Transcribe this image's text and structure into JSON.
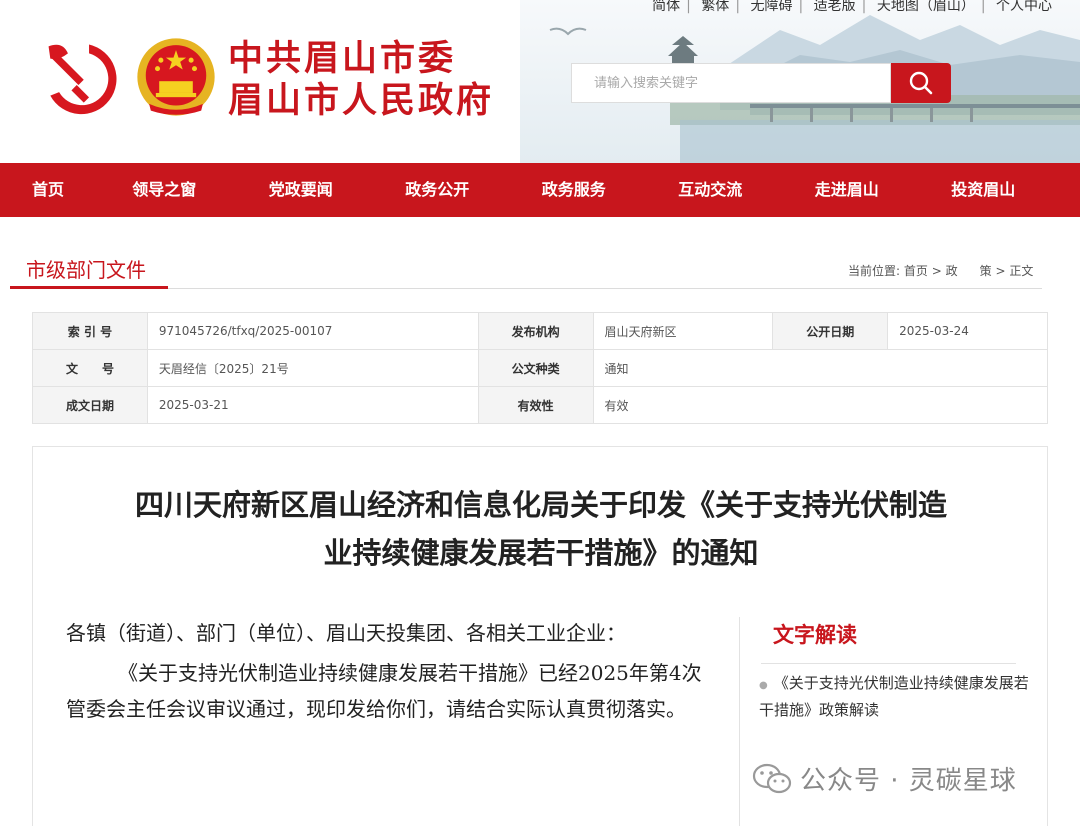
{
  "header": {
    "top_links": [
      "简体",
      "繁体",
      "无障碍",
      "适老版",
      "天地图（眉山）",
      "个人中心"
    ],
    "title_line1": "中共眉山市委",
    "title_line2": "眉山市人民政府",
    "search_placeholder": "请输入搜索关键字",
    "search_icon": "search-icon"
  },
  "nav": {
    "items": [
      "首页",
      "领导之窗",
      "党政要闻",
      "政务公开",
      "政务服务",
      "互动交流",
      "走进眉山",
      "投资眉山"
    ]
  },
  "section": {
    "title": "市级部门文件",
    "breadcrumb_prefix": "当前位置:",
    "breadcrumb_home": "首页",
    "breadcrumb_part1": "政",
    "breadcrumb_part2": "策",
    "breadcrumb_current": "正文"
  },
  "meta": {
    "index_label": "索 引 号",
    "index_value": "971045726/tfxq/2025-00107",
    "publisher_label": "发布机构",
    "publisher_value": "眉山天府新区",
    "public_date_label": "公开日期",
    "public_date_value": "2025-03-24",
    "doc_no_label": "文　　号",
    "doc_no_value": "天眉经信〔2025〕21号",
    "doc_type_label": "公文种类",
    "doc_type_value": "通知",
    "created_label": "成文日期",
    "created_value": "2025-03-21",
    "validity_label": "有效性",
    "validity_value": "有效"
  },
  "article": {
    "title_line1": "四川天府新区眉山经济和信息化局关于印发《关于支持光伏制造",
    "title_line2": "业持续健康发展若干措施》的通知",
    "salutation": "各镇（街道）、部门（单位）、眉山天投集团、各相关工业企业：",
    "paragraph1": "《关于支持光伏制造业持续健康发展若干措施》已经2025年第4次管委会主任会议审议通过，现印发给你们，请结合实际认真贯彻落实。"
  },
  "sidebar": {
    "title": "文字解读",
    "item1": "《关于支持光伏制造业持续健康发展若干措施》政策解读"
  },
  "watermark": {
    "text": "公众号 · 灵碳星球"
  },
  "colors": {
    "brand_red": "#c8161d"
  }
}
